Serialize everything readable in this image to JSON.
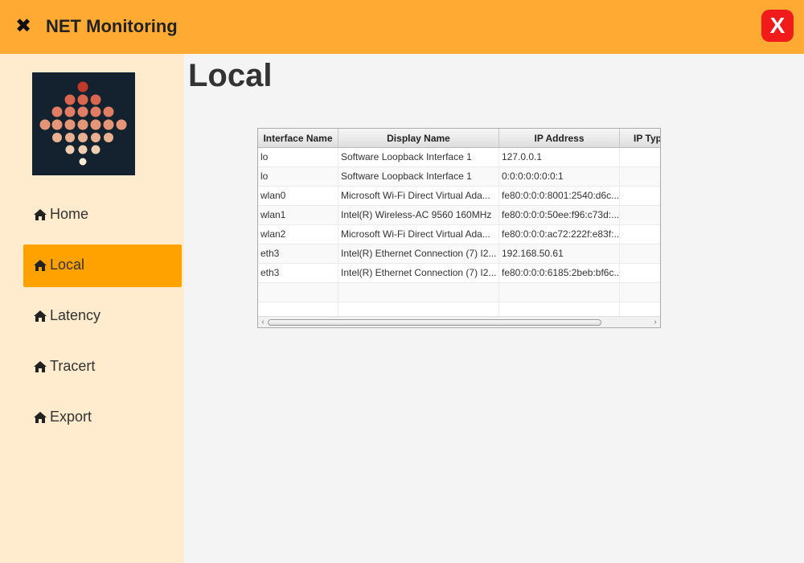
{
  "app": {
    "title": "NET Monitoring",
    "close_label": "X"
  },
  "icons": {
    "menu_glyph": "✖",
    "nav_icon": "home-icon"
  },
  "colors": {
    "titlebar": "#ffab33",
    "sidebar": "#ffebcd",
    "active_nav": "#ffa200",
    "close": "#f21b1b",
    "logo_bg": "#13222e"
  },
  "sidebar": {
    "items": [
      {
        "label": "Home",
        "active": false
      },
      {
        "label": "Local",
        "active": true
      },
      {
        "label": "Latency",
        "active": false
      },
      {
        "label": "Tracert",
        "active": false
      },
      {
        "label": "Export",
        "active": false
      }
    ]
  },
  "main": {
    "title": "Local"
  },
  "table": {
    "columns": [
      "Interface Name",
      "Display Name",
      "IP Address",
      "IP Typ"
    ],
    "rows": [
      [
        "lo",
        "Software Loopback Interface 1",
        "127.0.0.1",
        ""
      ],
      [
        "lo",
        "Software Loopback Interface 1",
        "0:0:0:0:0:0:0:1",
        ""
      ],
      [
        "wlan0",
        "Microsoft Wi-Fi Direct Virtual Ada...",
        "fe80:0:0:0:8001:2540:d6c...",
        ""
      ],
      [
        "wlan1",
        "Intel(R) Wireless-AC 9560 160MHz",
        "fe80:0:0:0:50ee:f96:c73d:...",
        ""
      ],
      [
        "wlan2",
        "Microsoft Wi-Fi Direct Virtual Ada...",
        "fe80:0:0:0:ac72:222f:e83f:...",
        ""
      ],
      [
        "eth3",
        "Intel(R) Ethernet Connection (7) I2...",
        "192.168.50.61",
        ""
      ],
      [
        "eth3",
        "Intel(R) Ethernet Connection (7) I2...",
        "fe80:0:0:0:6185:2beb:bf6c...",
        ""
      ],
      [
        "",
        "",
        "",
        ""
      ],
      [
        "",
        "",
        "",
        ""
      ]
    ]
  },
  "scrollbar": {
    "left_arrow": "‹",
    "right_arrow": "›"
  }
}
